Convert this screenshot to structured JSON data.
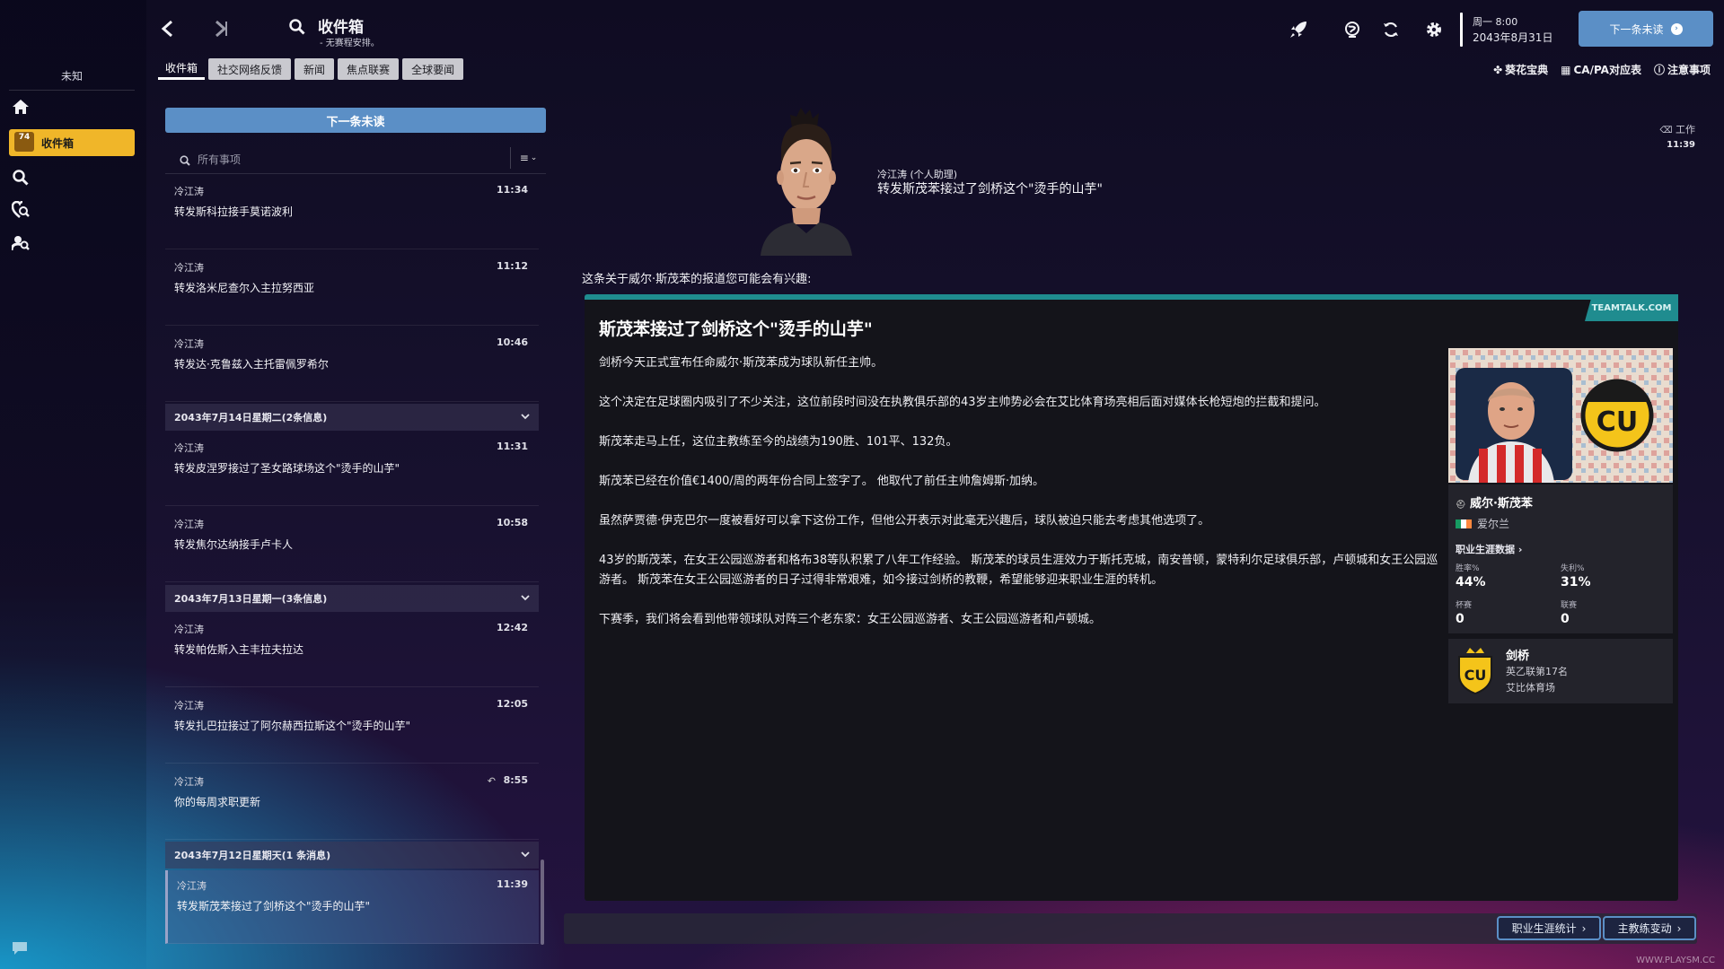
{
  "sidebar": {
    "manager_label": "未知",
    "inbox_label": "收件箱",
    "inbox_badge": "74"
  },
  "topbar": {
    "title": "收件箱",
    "subtitle": "- 无赛程安排。",
    "date_line1": "周一 8:00",
    "date_line2": "2043年8月31日",
    "next_unread_label": "下一条未读"
  },
  "tabs": [
    {
      "label": "收件箱",
      "active": true
    },
    {
      "label": "社交网络反馈",
      "active": false
    },
    {
      "label": "新闻",
      "active": false
    },
    {
      "label": "焦点联赛",
      "active": false
    },
    {
      "label": "全球要闻",
      "active": false
    }
  ],
  "right_links": [
    "葵花宝典",
    "CA/PA对应表",
    "注意事项"
  ],
  "list": {
    "next_unread_label": "下一条未读",
    "search_placeholder": "所有事项",
    "messages_top": [
      {
        "from": "冷江涛",
        "time": "11:34",
        "subject": "转发斯科拉接手莫诺波利"
      },
      {
        "from": "冷江涛",
        "time": "11:12",
        "subject": "转发洛米尼查尔入主拉努西亚"
      },
      {
        "from": "冷江涛",
        "time": "10:46",
        "subject": "转发达·克鲁兹入主托雷佩罗希尔"
      }
    ],
    "group1": "2043年7月14日星期二(2条信息)",
    "messages_g1": [
      {
        "from": "冷江涛",
        "time": "11:31",
        "subject": "转发皮涅罗接过了圣女路球场这个\"烫手的山芋\""
      },
      {
        "from": "冷江涛",
        "time": "10:58",
        "subject": "转发焦尔达纳接手卢卡人"
      }
    ],
    "group2": "2043年7月13日星期一(3条信息)",
    "messages_g2": [
      {
        "from": "冷江涛",
        "time": "12:42",
        "subject": "转发帕佐斯入主丰拉夫拉达"
      },
      {
        "from": "冷江涛",
        "time": "12:05",
        "subject": "转发扎巴拉接过了阿尔赫西拉斯这个\"烫手的山芋\""
      },
      {
        "from": "冷江涛",
        "time": "8:55",
        "subject": "你的每周求职更新"
      }
    ],
    "group3": "2043年7月12日星期天(1 条消息)",
    "messages_g3": [
      {
        "from": "冷江涛",
        "time": "11:39",
        "subject": "转发斯茂苯接过了剑桥这个\"烫手的山芋\""
      }
    ]
  },
  "message": {
    "sender": "冷江涛 (个人助理)",
    "subject": "转发斯茂苯接过了剑桥这个\"烫手的山芋\"",
    "tag": "工作",
    "tag_time": "11:39",
    "intro": "这条关于威尔·斯茂苯的报道您可能会有兴趣:",
    "source": "TEAMTALK.COM",
    "article_title": "斯茂苯接过了剑桥这个\"烫手的山芋\"",
    "paragraphs": [
      "剑桥今天正式宣布任命威尔·斯茂苯成为球队新任主帅。",
      "这个决定在足球圈内吸引了不少关注，这位前段时间没在执教俱乐部的43岁主帅势必会在艾比体育场亮相后面对媒体长枪短炮的拦截和提问。",
      "斯茂苯走马上任，这位主教练至今的战绩为190胜、101平、132负。",
      "斯茂苯已经在价值€1400/周的两年份合同上签字了。 他取代了前任主帅詹姆斯·加纳。",
      "虽然萨贾德·伊克巴尔一度被看好可以拿下这份工作，但他公开表示对此毫无兴趣后，球队被迫只能去考虑其他选项了。",
      "43岁的斯茂苯，在女王公园巡游者和格布38等队积累了八年工作经验。 斯茂苯的球员生涯效力于斯托克城，南安普顿，蒙特利尔足球俱乐部，卢顿城和女王公园巡游者。 斯茂苯在女王公园巡游者的日子过得非常艰难，如今接过剑桥的教鞭，希望能够迎来职业生涯的转机。",
      "下赛季，我们将会看到他带领球队对阵三个老东家：女王公园巡游者、女王公园巡游者和卢顿城。"
    ]
  },
  "person_card": {
    "name": "威尔·斯茂苯",
    "nationality": "爱尔兰",
    "career_link": "职业生涯数据",
    "stats": [
      {
        "label": "胜率%",
        "value": "44%"
      },
      {
        "label": "失利%",
        "value": "31%"
      },
      {
        "label": "杯赛",
        "value": "0"
      },
      {
        "label": "联赛",
        "value": "0"
      }
    ],
    "club_name": "剑桥",
    "club_league": "英乙联第17名",
    "club_stadium": "艾比体育场",
    "crest_text": "CU"
  },
  "bottom_buttons": [
    "职业生涯统计",
    "主教练变动"
  ],
  "watermark": "WWW.PLAYSM.CC",
  "colors": {
    "accent": "#5b8fc6",
    "highlight": "#f0b629",
    "teamtalk": "#1f8c8f"
  }
}
